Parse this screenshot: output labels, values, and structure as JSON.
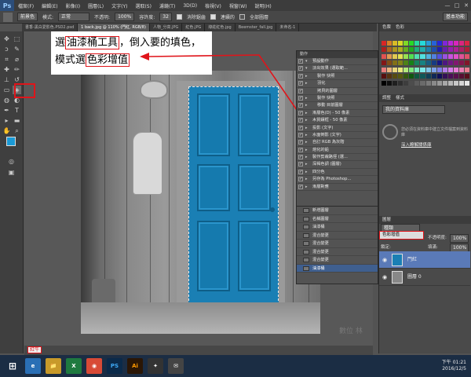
{
  "app": {
    "logo": "Ps",
    "menu": [
      "檔案(F)",
      "編輯(E)",
      "影像(I)",
      "圖層(L)",
      "文字(Y)",
      "選取(S)",
      "濾鏡(T)",
      "3D(D)",
      "檢視(V)",
      "視窗(W)",
      "說明(H)"
    ],
    "window_controls": [
      "—",
      "□",
      "✕"
    ]
  },
  "options": {
    "preset": "前景色",
    "mode_label": "模式:",
    "mode_value": "正常",
    "opacity_label": "不透明:",
    "opacity_value": "100%",
    "tolerance_label": "容許度:",
    "tolerance_value": "32",
    "antialias": "消除鋸齒",
    "contiguous": "連續的",
    "all_layers": "全部圖層",
    "workspace": "基本功能"
  },
  "tabs": [
    {
      "label": "書香-黑白愛影色.PSD2.psd",
      "active": false
    },
    {
      "label": "1 back.jpg @ 110% (門紅, RGB/8)",
      "active": true
    },
    {
      "label": "人物_分高.JPG",
      "active": false
    },
    {
      "label": "紅色.JPG",
      "active": false
    },
    {
      "label": "綠莊紅色.jpg",
      "active": false
    },
    {
      "label": "Beemster_fall.jpg",
      "active": false
    },
    {
      "label": "未命名-1",
      "active": false
    }
  ],
  "annotation": {
    "line1_pre": "選",
    "line1_hl": "油漆桶工具",
    "line1_post": "，倒入要的填色，",
    "line2_pre": "模式選",
    "line2_hl": "色彩增值"
  },
  "actions_panel": {
    "title": "動作",
    "items": [
      "預設動作",
      "淡出效果 (選取範...",
      "製作 快照",
      "羽化",
      "拷貝的圖層",
      "製作 快照",
      "移動 目前圖層",
      "漸層色(D) - 50 像素",
      "木質鑲框 - 50 像素",
      "投影 (文字)",
      "水面倒影 (文字)",
      "自訂 RGB 為灰階",
      "熔化的鉛",
      "製作剪裁路徑 (選...",
      "深褐色調 (圖層)",
      "四分色",
      "另存為 Photoshop...",
      "漸層對應"
    ]
  },
  "history_panel": {
    "items": [
      "新增圖層",
      "名稱圖層",
      "油漆桶",
      "混合變更",
      "混合變更",
      "混合變更",
      "混合變更",
      "油漆桶"
    ]
  },
  "right_panel": {
    "tab_color": "色票",
    "tab_swatch": "色彩",
    "tab_adjust": "調整",
    "tab_style": "樣式",
    "lib_dropdown": "我的資料庫",
    "lib_msg": "您必須在資料庫中建立文件檔案到資料庫",
    "lib_link": "深入瞭解關係庫",
    "layers_tab": "圖層",
    "layer_kind": "種類",
    "blend_mode": "色彩增值",
    "opacity_label": "不透明度:",
    "opacity_value": "100%",
    "lock_label": "鎖定:",
    "fill_label": "填滿:",
    "fill_value": "100%",
    "layers": [
      "門紅",
      "圖層 0"
    ]
  },
  "status": {
    "zoom": "紅牛"
  },
  "watermark": "數位\n林",
  "taskbar": {
    "clock_time": "下午 01:21",
    "clock_date": "2016/12/5",
    "apps": [
      "⊞",
      "e",
      "📁",
      "X",
      "◉",
      "PS",
      "Ai",
      "✦",
      "✉"
    ]
  },
  "colors": {
    "door": "#1a7fb4",
    "highlight": "#e0141a",
    "taskbar": "#1b2d44"
  }
}
